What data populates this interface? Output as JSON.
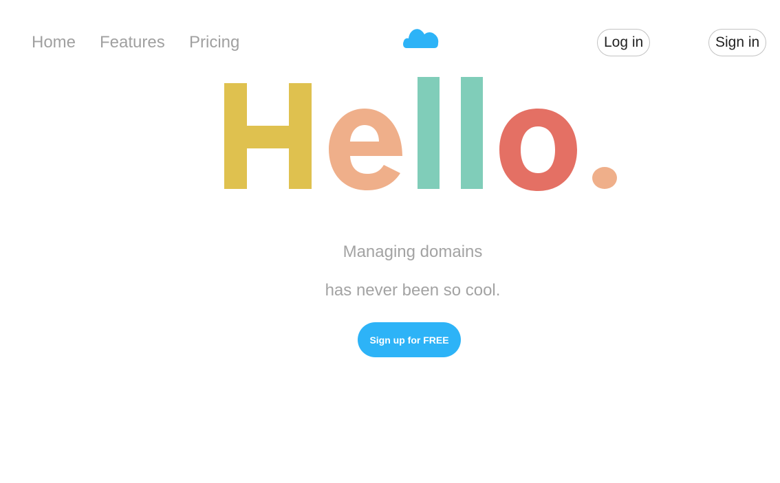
{
  "nav": {
    "home": "Home",
    "features": "Features",
    "pricing": "Pricing"
  },
  "logo": {
    "icon": "cloud-icon",
    "color": "#2db3f7"
  },
  "auth": {
    "login_label": "Log in",
    "signin_label": "Sign in"
  },
  "hero": {
    "letters": [
      {
        "char": "H",
        "color": "#dfc14f"
      },
      {
        "char": "e",
        "color": "#efaf8a"
      },
      {
        "char": "l",
        "color": "#80cdb9"
      },
      {
        "char": "l",
        "color": "#80cdb9"
      },
      {
        "char": "o",
        "color": "#e47064"
      },
      {
        "char": ".",
        "color": "#efaf8a"
      }
    ]
  },
  "tagline": {
    "line1": "Managing domains",
    "line2": "has never been so cool."
  },
  "cta": {
    "label": "Sign up for FREE",
    "color": "#2db3f7"
  }
}
